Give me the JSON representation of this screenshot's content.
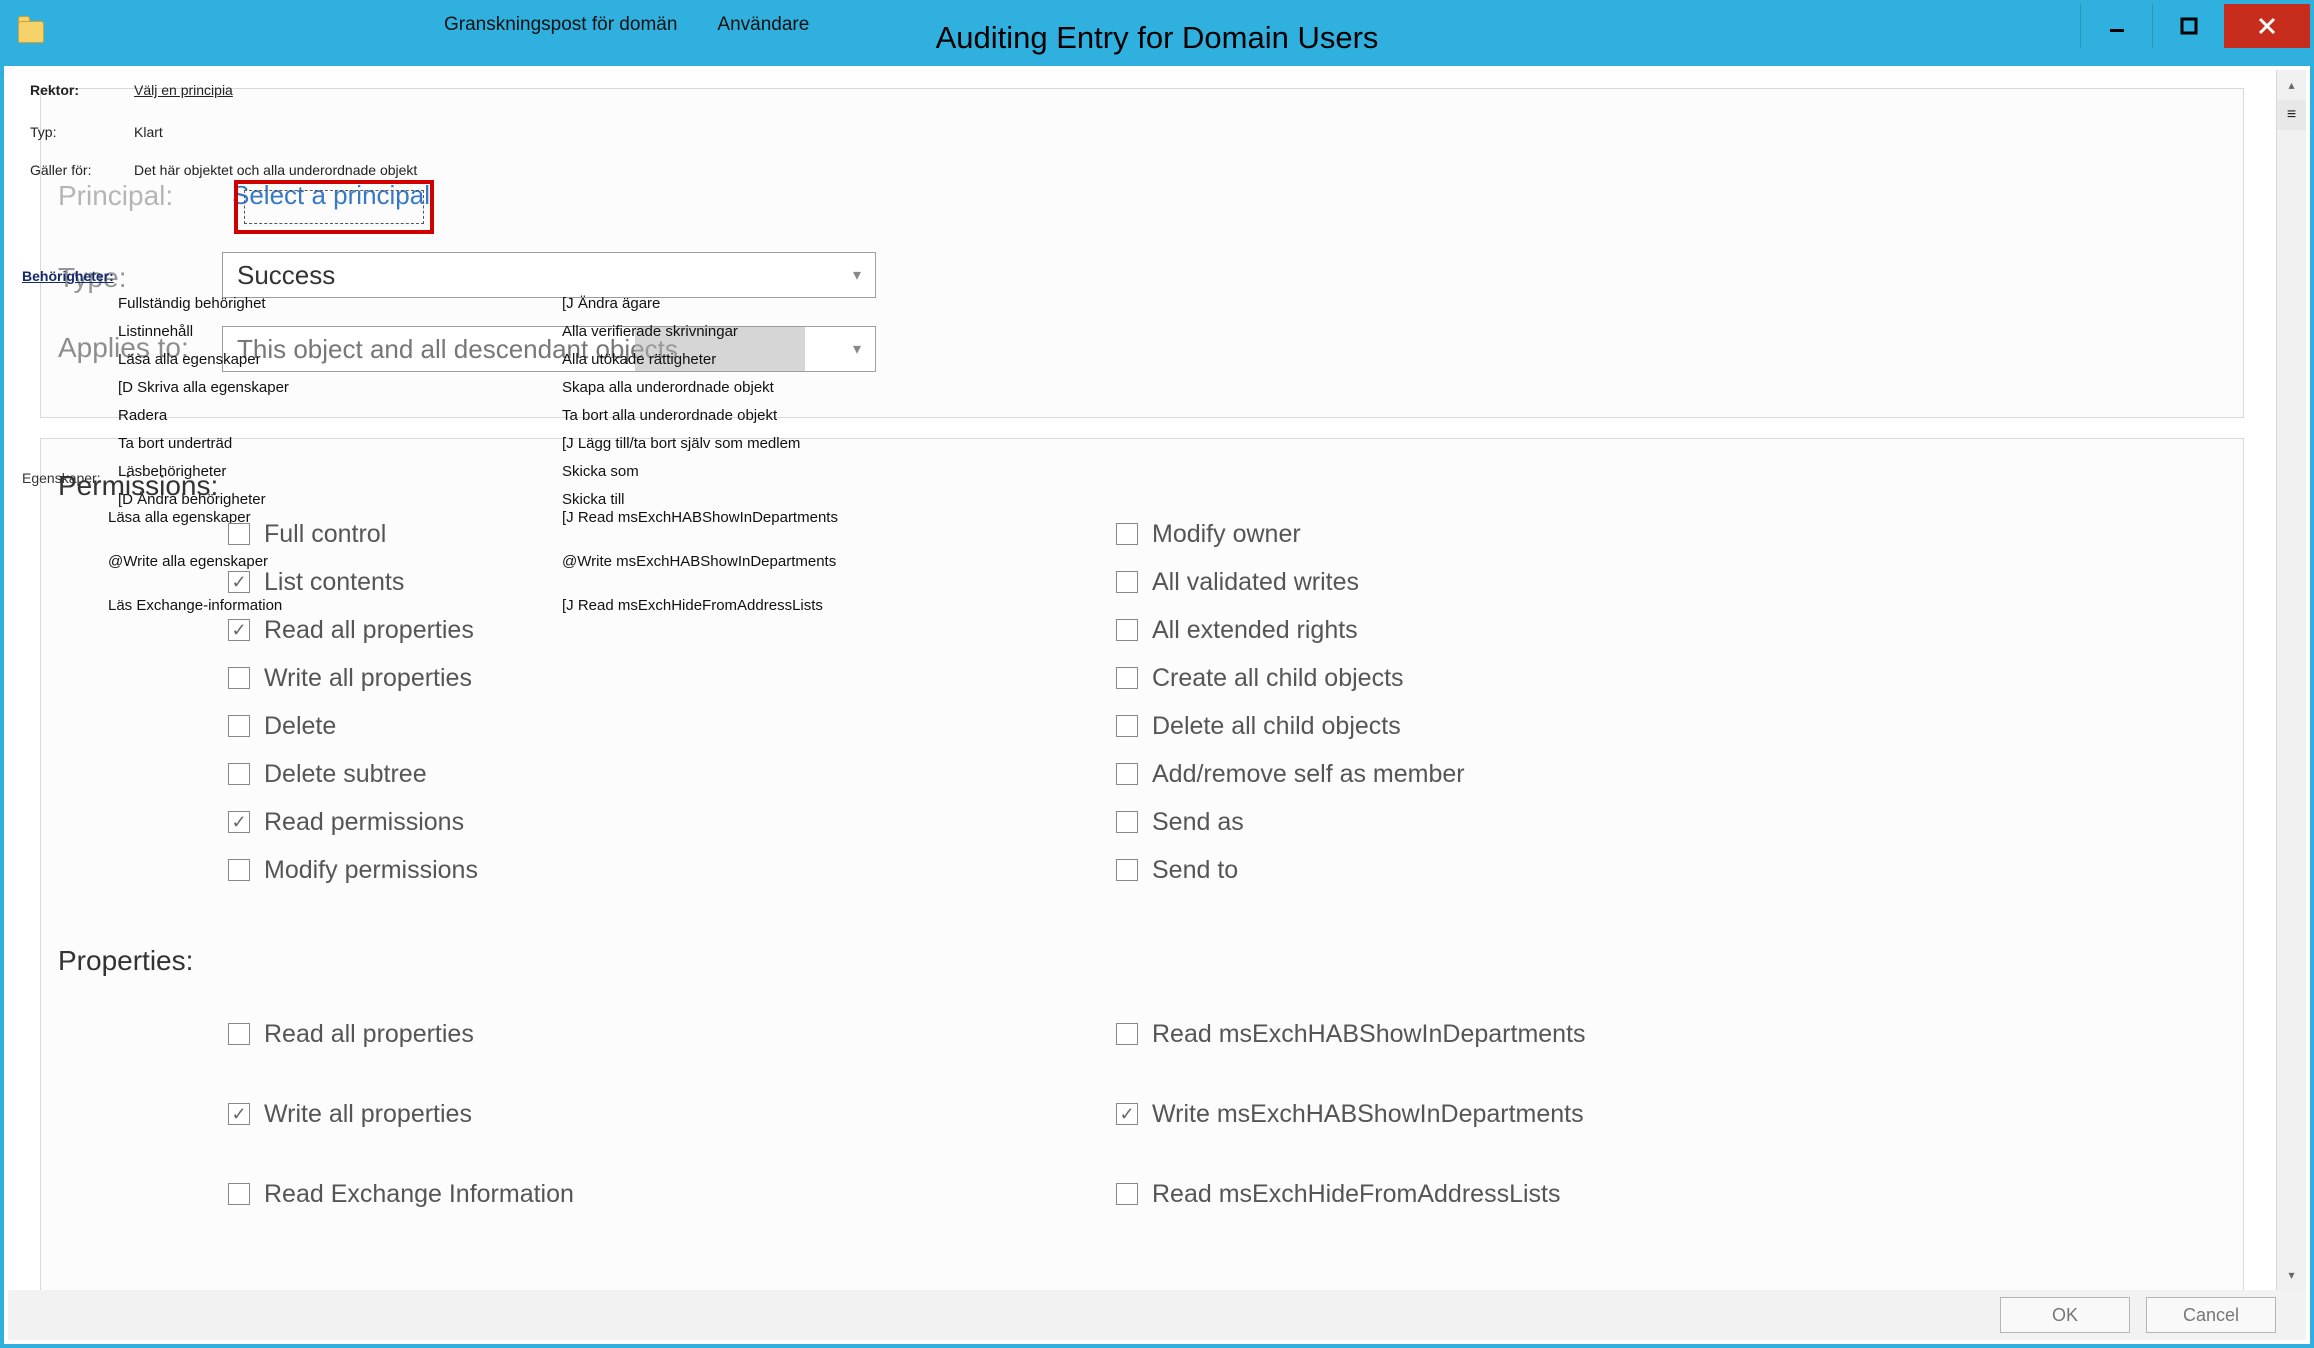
{
  "titlebar": {
    "tab1": "Granskningspost för domän",
    "tab2": "Användare",
    "main_title": "Auditing Entry for Domain Users"
  },
  "meta": {
    "rektor_label": "Rektor:",
    "rektor_value": "Välj en principia",
    "typ_label": "Typ:",
    "typ_value": "Klart",
    "galler_label": "Gäller för:",
    "galler_value": "Det här objektet och alla underordnade objekt"
  },
  "ghost": {
    "principal_label": "Principal:",
    "select_principal_link": "Select a principal",
    "type_label": "Type:",
    "type_value": "Success",
    "applies_label": "Applies to:",
    "applies_value": "This object and all descendant objects",
    "permissions_heading": "Permissions:",
    "properties_heading": "Properties:"
  },
  "permissions_left": [
    {
      "label": "Full control",
      "checked": false
    },
    {
      "label": "List contents",
      "checked": true
    },
    {
      "label": "Read all properties",
      "checked": true
    },
    {
      "label": "Write all properties",
      "checked": false
    },
    {
      "label": "Delete",
      "checked": false
    },
    {
      "label": "Delete subtree",
      "checked": false
    },
    {
      "label": "Read permissions",
      "checked": true
    },
    {
      "label": "Modify permissions",
      "checked": false
    }
  ],
  "permissions_right": [
    {
      "label": "Modify owner",
      "checked": false
    },
    {
      "label": "All validated writes",
      "checked": false
    },
    {
      "label": "All extended rights",
      "checked": false
    },
    {
      "label": "Create all child objects",
      "checked": false
    },
    {
      "label": "Delete all child objects",
      "checked": false
    },
    {
      "label": "Add/remove self as member",
      "checked": false
    },
    {
      "label": "Send as",
      "checked": false
    },
    {
      "label": "Send to",
      "checked": false
    }
  ],
  "properties_left": [
    {
      "label": "Read all properties",
      "checked": false
    },
    {
      "label": "Write all properties",
      "checked": true
    },
    {
      "label": "Read Exchange Information",
      "checked": false
    }
  ],
  "properties_right": [
    {
      "label": "Read msExchHABShowInDepartments",
      "checked": false
    },
    {
      "label": "Write msExchHABShowInDepartments",
      "checked": true
    },
    {
      "label": "Read msExchHideFromAddressLists",
      "checked": false
    }
  ],
  "legacy_left": [
    "Fullständig behörighet",
    "Listinnehåll",
    "Läsa alla egenskaper",
    "[D Skriva alla egenskaper",
    "Radera",
    "Ta bort underträd",
    "Läsbehörigheter",
    "[D Ändra behörigheter"
  ],
  "legacy_right": [
    "[J Ändra ägare",
    "Alla verifierade skrivningar",
    "Alla utökade rättigheter",
    "Skapa alla underordnade objekt",
    "Ta bort alla underordnade objekt",
    "[J Lägg till/ta bort själv som medlem",
    "Skicka som",
    "Skicka till"
  ],
  "legacy_props_left": [
    "Läsa alla egenskaper",
    "@Write alla egenskaper",
    "Läs Exchange-information"
  ],
  "legacy_props_right": [
    "[J Read msExchHABShowInDepartments",
    "@Write msExchHABShowInDepartments",
    "[J Read msExchHideFromAddressLists"
  ],
  "sv_perm_label": "Behörigheter:",
  "sv_props_label": "Egenskaper:",
  "buttons": {
    "ok": "OK",
    "cancel": "Cancel"
  }
}
